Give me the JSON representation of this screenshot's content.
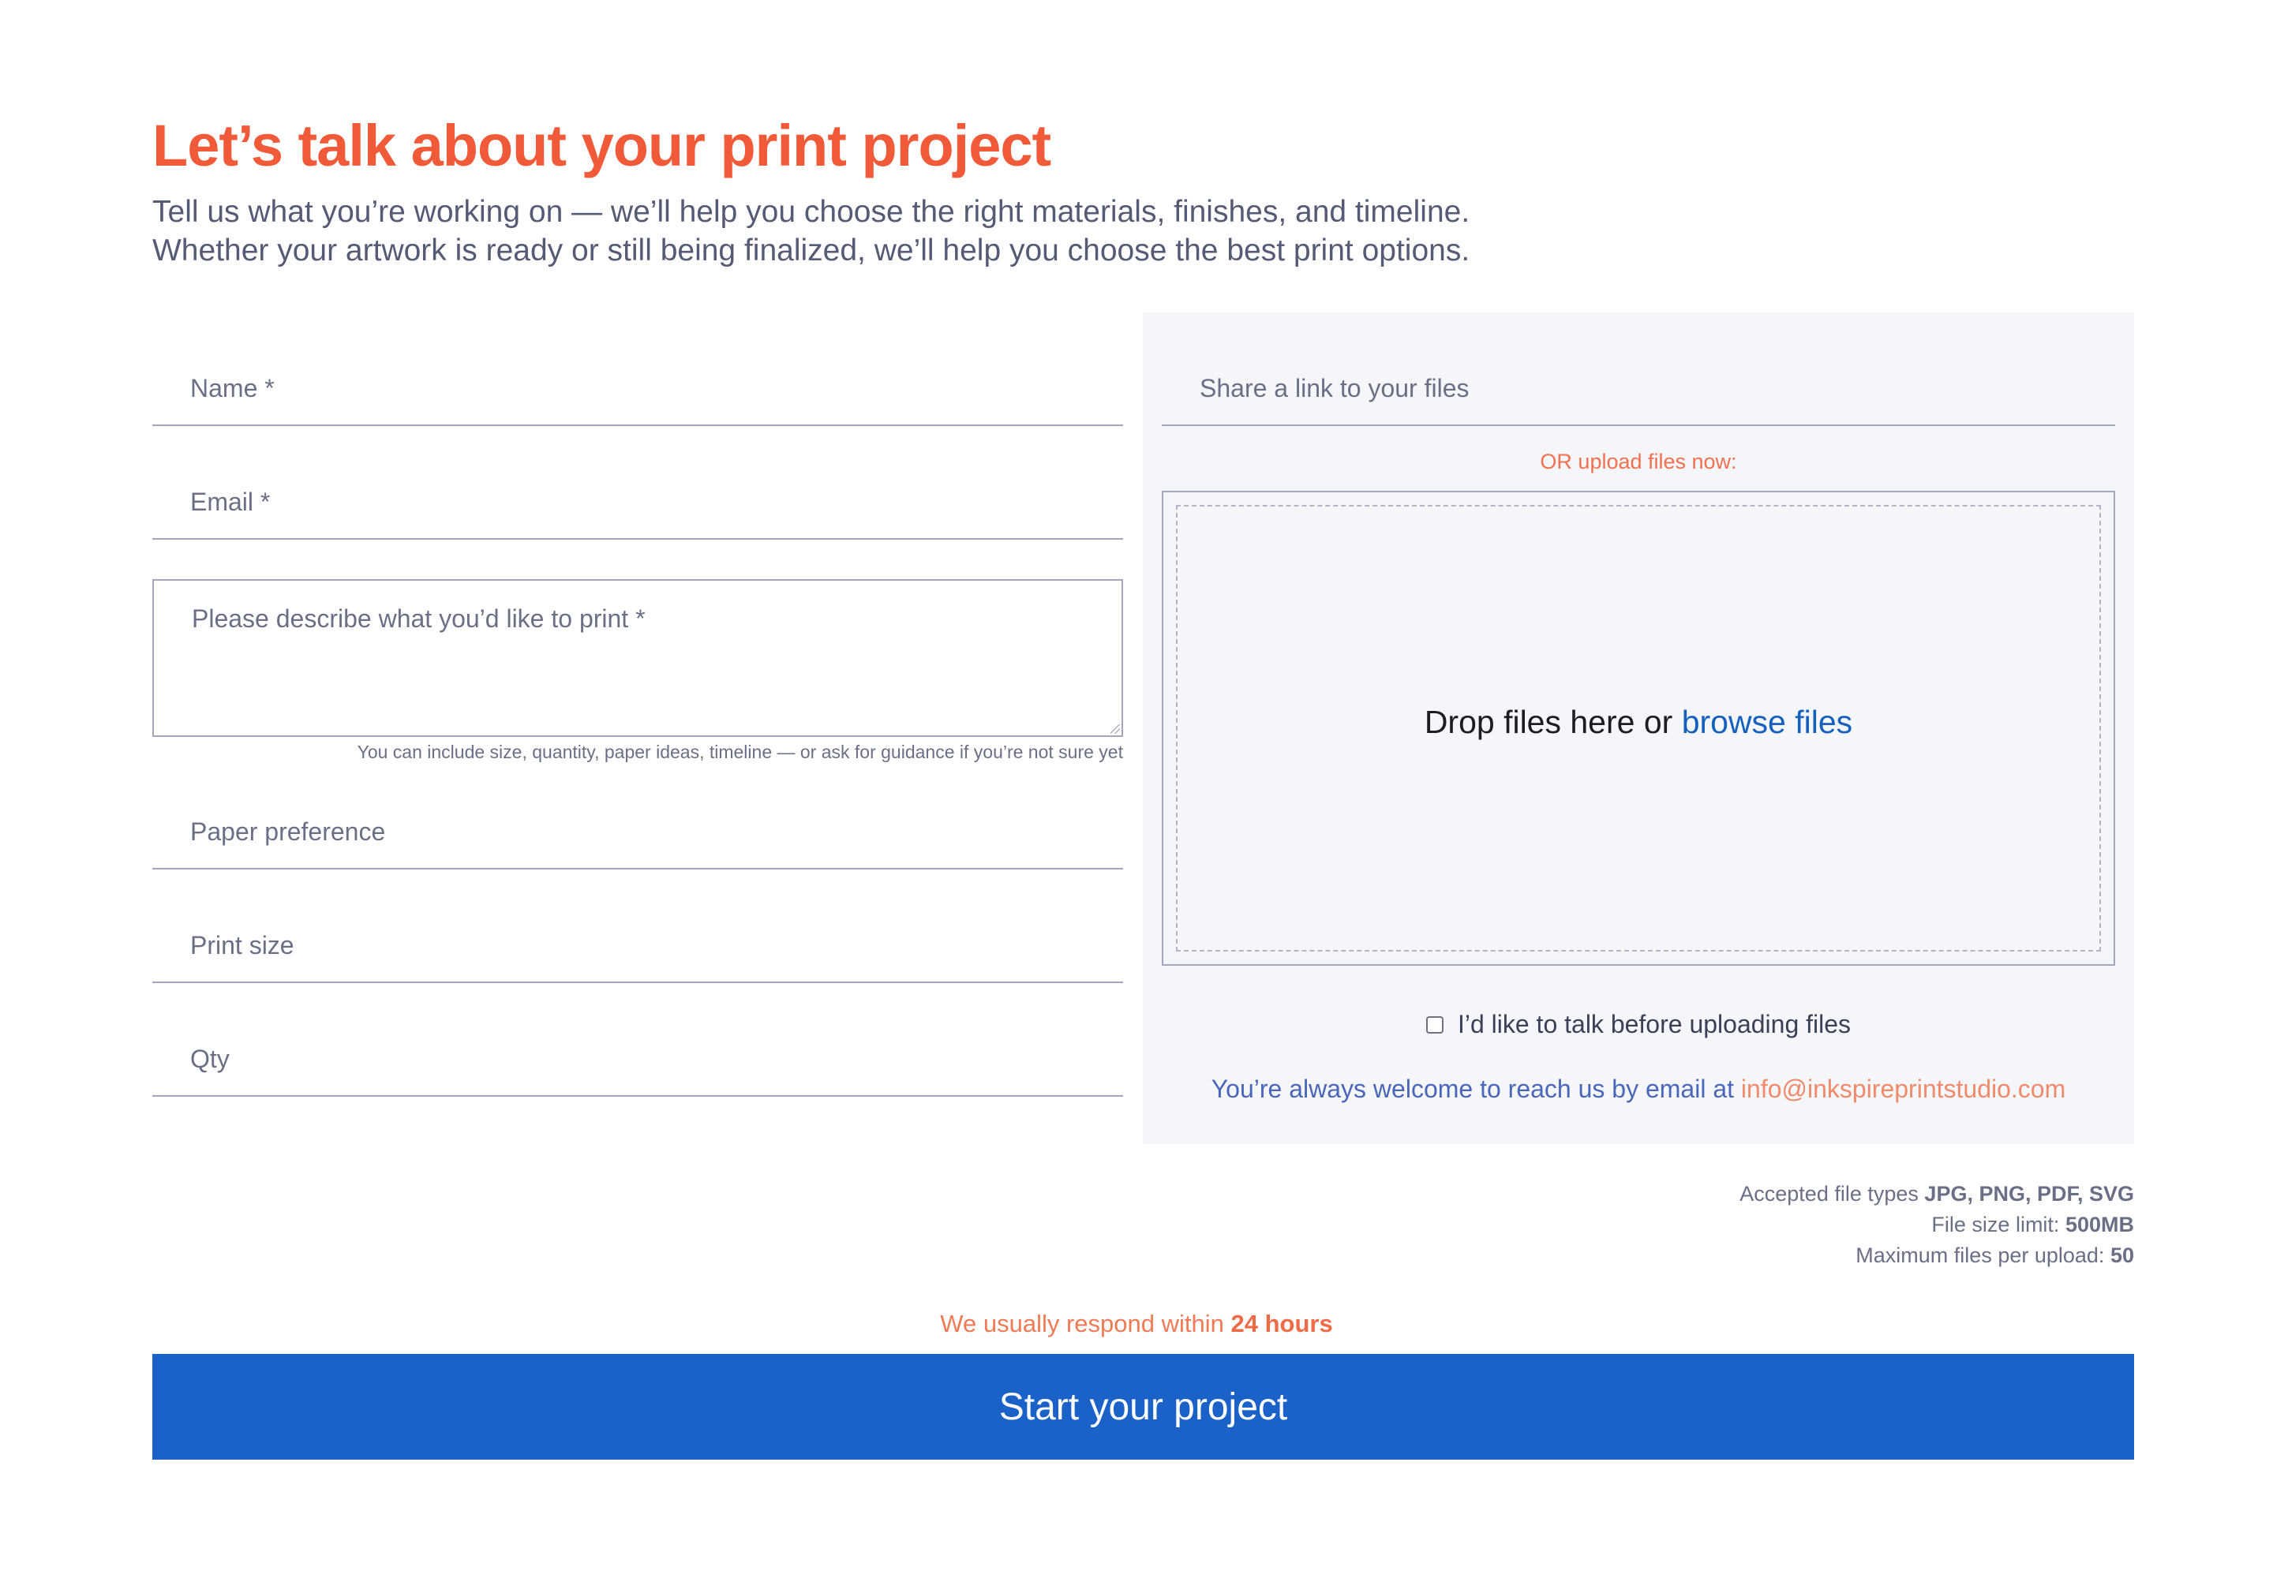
{
  "header": {
    "title": "Let’s talk about your print project",
    "intro_line_1": "Tell us what you’re working on — we’ll help you choose the right materials, finishes, and timeline.",
    "intro_line_2": "Whether your artwork is ready or still being finalized, we’ll help you choose the best print options."
  },
  "form": {
    "name_placeholder": "Name *",
    "email_placeholder": "Email *",
    "description_placeholder": "Please describe what you’d like to print *",
    "description_hint": "You can include size, quantity, paper ideas, timeline — or ask for guidance if you’re not sure yet",
    "paper_placeholder": "Paper preference",
    "size_placeholder": "Print size",
    "qty_placeholder": "Qty"
  },
  "upload": {
    "link_placeholder": "Share a link to your files",
    "or_upload_label": "OR upload files now:",
    "drop_text": "Drop files here or",
    "browse_label": "browse files",
    "talk_checkbox_label": "I’d like to talk before uploading files",
    "reach_text": "You’re always welcome to reach us by email at",
    "email": "info@inkspireprintstudio.com"
  },
  "file_info": {
    "types_label": "Accepted file types",
    "types_value": "JPG, PNG, PDF, SVG",
    "size_label": "File size limit:",
    "size_value": "500MB",
    "max_label": "Maximum files per upload:",
    "max_value": "50"
  },
  "footer": {
    "respond_text": "We usually respond within",
    "respond_value": "24 hours",
    "submit_label": "Start your project"
  },
  "colors": {
    "accent_orange": "#f05a38",
    "primary_blue": "#1a61c8",
    "link_blue": "#1560bd",
    "panel_bg": "#f5f6fa"
  }
}
